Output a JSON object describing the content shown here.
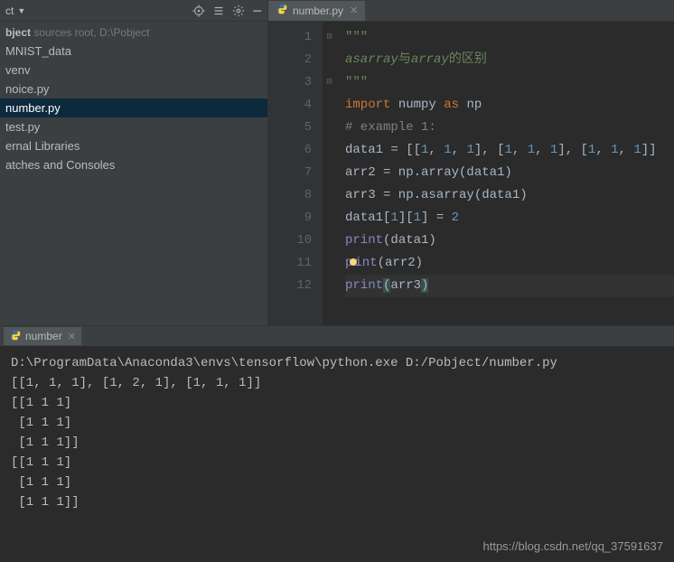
{
  "sidebar": {
    "title": "ct",
    "root_label": "bject",
    "root_meta": "sources root,  D:\\Pobject",
    "items": [
      {
        "label": "MNIST_data",
        "selected": false
      },
      {
        "label": "venv",
        "selected": false
      },
      {
        "label": "noice.py",
        "selected": false
      },
      {
        "label": "number.py",
        "selected": true
      },
      {
        "label": "test.py",
        "selected": false
      },
      {
        "label": "ernal Libraries",
        "selected": false
      },
      {
        "label": "atches and Consoles",
        "selected": false
      }
    ]
  },
  "editor": {
    "tab_label": "number.py",
    "lines": [
      {
        "n": 1,
        "tokens": [
          {
            "t": "\"\"\"",
            "c": "c-str"
          }
        ]
      },
      {
        "n": 2,
        "tokens": [
          {
            "t": "asarray",
            "c": "c-str-i"
          },
          {
            "t": "与",
            "c": "c-str"
          },
          {
            "t": "array",
            "c": "c-str-i"
          },
          {
            "t": "的区别",
            "c": "c-str"
          }
        ]
      },
      {
        "n": 3,
        "tokens": [
          {
            "t": "\"\"\"",
            "c": "c-str"
          }
        ]
      },
      {
        "n": 4,
        "tokens": [
          {
            "t": "import ",
            "c": "c-kw"
          },
          {
            "t": "numpy ",
            "c": "c-id"
          },
          {
            "t": "as ",
            "c": "c-kw"
          },
          {
            "t": "np",
            "c": "c-id"
          }
        ]
      },
      {
        "n": 5,
        "tokens": [
          {
            "t": "# example 1:",
            "c": "c-com"
          }
        ]
      },
      {
        "n": 6,
        "tokens": [
          {
            "t": "data1 = [[",
            "c": "c-id"
          },
          {
            "t": "1",
            "c": "c-num"
          },
          {
            "t": ", ",
            "c": "c-id"
          },
          {
            "t": "1",
            "c": "c-num"
          },
          {
            "t": ", ",
            "c": "c-id"
          },
          {
            "t": "1",
            "c": "c-num"
          },
          {
            "t": "], [",
            "c": "c-id"
          },
          {
            "t": "1",
            "c": "c-num"
          },
          {
            "t": ", ",
            "c": "c-id"
          },
          {
            "t": "1",
            "c": "c-num"
          },
          {
            "t": ", ",
            "c": "c-id"
          },
          {
            "t": "1",
            "c": "c-num"
          },
          {
            "t": "], [",
            "c": "c-id"
          },
          {
            "t": "1",
            "c": "c-num"
          },
          {
            "t": ", ",
            "c": "c-id"
          },
          {
            "t": "1",
            "c": "c-num"
          },
          {
            "t": ", ",
            "c": "c-id"
          },
          {
            "t": "1",
            "c": "c-num"
          },
          {
            "t": "]]",
            "c": "c-id"
          }
        ]
      },
      {
        "n": 7,
        "tokens": [
          {
            "t": "arr2 = np.array(data1)",
            "c": "c-id"
          }
        ]
      },
      {
        "n": 8,
        "tokens": [
          {
            "t": "arr3 = np.asarray(data1)",
            "c": "c-id"
          }
        ]
      },
      {
        "n": 9,
        "tokens": [
          {
            "t": "data1[",
            "c": "c-id"
          },
          {
            "t": "1",
            "c": "c-num"
          },
          {
            "t": "][",
            "c": "c-id"
          },
          {
            "t": "1",
            "c": "c-num"
          },
          {
            "t": "] = ",
            "c": "c-id"
          },
          {
            "t": "2",
            "c": "c-num"
          }
        ]
      },
      {
        "n": 10,
        "tokens": [
          {
            "t": "print",
            "c": "c-bi"
          },
          {
            "t": "(data1)",
            "c": "c-id"
          }
        ]
      },
      {
        "n": 11,
        "tokens": [
          {
            "t": "p",
            "c": "c-bi"
          },
          {
            "t": "",
            "c": "caret-dot"
          },
          {
            "t": "int",
            "c": "c-bi"
          },
          {
            "t": "(arr2)",
            "c": "c-id"
          }
        ]
      },
      {
        "n": 12,
        "hl": true,
        "tokens": [
          {
            "t": "print",
            "c": "c-bi"
          },
          {
            "t": "(",
            "c": "c-id c-bracket-match"
          },
          {
            "t": "arr3",
            "c": "c-id"
          },
          {
            "t": ")",
            "c": "c-id c-bracket-match"
          }
        ]
      }
    ]
  },
  "console": {
    "tab_label": "number",
    "lines": [
      "D:\\ProgramData\\Anaconda3\\envs\\tensorflow\\python.exe D:/Pobject/number.py",
      "[[1, 1, 1], [1, 2, 1], [1, 1, 1]]",
      "[[1 1 1]",
      " [1 1 1]",
      " [1 1 1]]",
      "[[1 1 1]",
      " [1 1 1]",
      " [1 1 1]]"
    ]
  },
  "watermark": "https://blog.csdn.net/qq_37591637"
}
